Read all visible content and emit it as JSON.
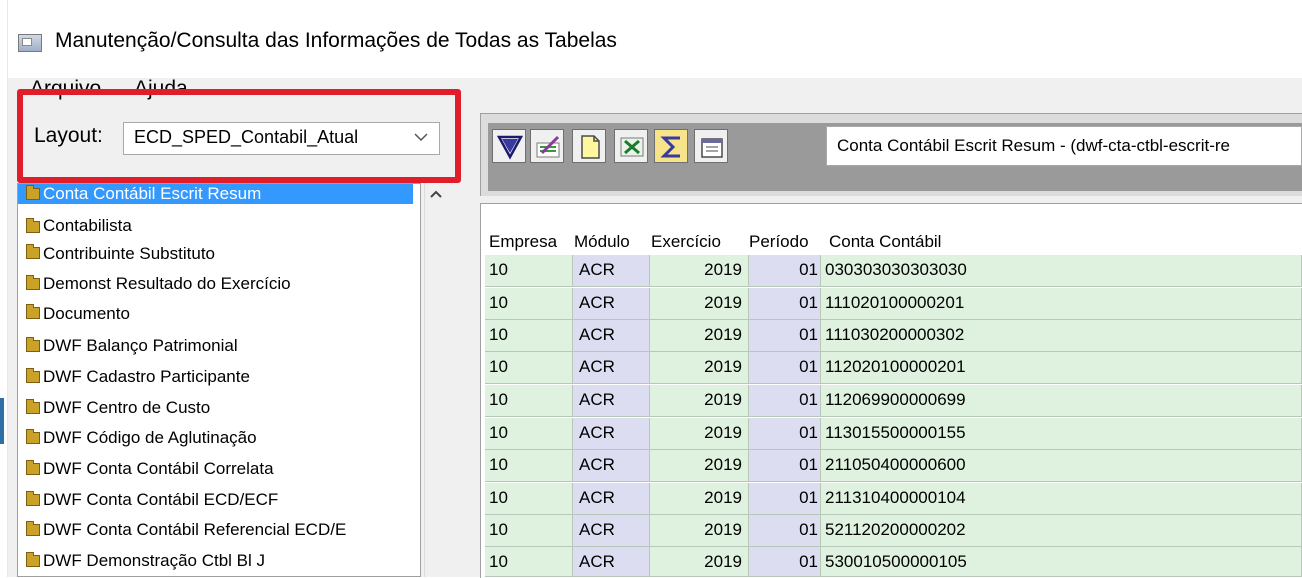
{
  "window": {
    "title": "Manutenção/Consulta das Informações de Todas as Tabelas"
  },
  "menu": {
    "items": [
      {
        "label": "Arquivo"
      },
      {
        "label": "Ajuda"
      }
    ]
  },
  "layout": {
    "label": "Layout:",
    "selected": "ECD_SPED_Contabil_Atual"
  },
  "tree": {
    "items": [
      {
        "label": "Conta Contábil  Escrit Resum",
        "selected": true
      },
      {
        "label": "Contabilista"
      },
      {
        "label": "Contribuinte Substituto"
      },
      {
        "label": "Demonst Resultado do Exercício"
      },
      {
        "label": "Documento"
      },
      {
        "label": "DWF Balanço Patrimonial"
      },
      {
        "label": "DWF Cadastro Participante"
      },
      {
        "label": "DWF Centro de Custo"
      },
      {
        "label": "DWF Código de Aglutinação"
      },
      {
        "label": "DWF Conta Contábil Correlata"
      },
      {
        "label": "DWF Conta Contábil ECD/ECF"
      },
      {
        "label": "DWF Conta Contábil Referencial ECD/E"
      },
      {
        "label": "DWF Demonstração Ctbl Bl J"
      }
    ]
  },
  "toolbar": {
    "buttons": [
      {
        "icon": "filter-funnel-icon"
      },
      {
        "icon": "edit-record-icon"
      },
      {
        "icon": "new-document-icon"
      },
      {
        "icon": "excel-export-icon"
      },
      {
        "icon": "sum-sigma-icon"
      },
      {
        "icon": "properties-icon"
      }
    ],
    "info_text": "Conta Contábil  Escrit Resum - (dwf-cta-ctbl-escrit-re"
  },
  "grid": {
    "columns": [
      "Empresa",
      "Módulo",
      "Exercício",
      "Período",
      "Conta Contábil"
    ],
    "rows": [
      [
        "10",
        "ACR",
        "2019",
        "01",
        "030303030303030"
      ],
      [
        "10",
        "ACR",
        "2019",
        "01",
        "111020100000201"
      ],
      [
        "10",
        "ACR",
        "2019",
        "01",
        "111030200000302"
      ],
      [
        "10",
        "ACR",
        "2019",
        "01",
        "112020100000201"
      ],
      [
        "10",
        "ACR",
        "2019",
        "01",
        "112069900000699"
      ],
      [
        "10",
        "ACR",
        "2019",
        "01",
        "113015500000155"
      ],
      [
        "10",
        "ACR",
        "2019",
        "01",
        "211050400000600"
      ],
      [
        "10",
        "ACR",
        "2019",
        "01",
        "211310400000104"
      ],
      [
        "10",
        "ACR",
        "2019",
        "01",
        "521120200000202"
      ],
      [
        "10",
        "ACR",
        "2019",
        "01",
        "530010500000105"
      ]
    ]
  },
  "colors": {
    "highlight_border": "#e01e2b",
    "selection": "#3399ff",
    "row_green": "#dff2df",
    "row_lavender": "#ddddf2"
  }
}
